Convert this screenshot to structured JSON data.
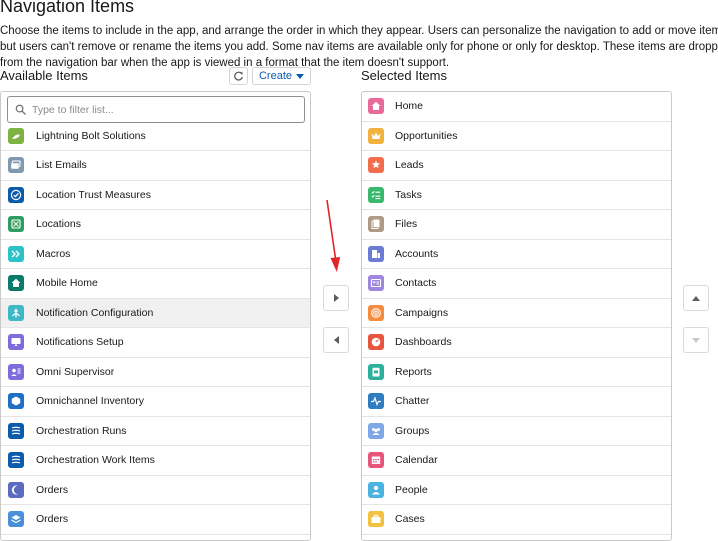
{
  "page": {
    "title": "Navigation Items",
    "description": "Choose the items to include in the app, and arrange the order in which they appear. Users can personalize the navigation to add or move items, but users can't remove or rename the items you add. Some nav items are available only for phone or only for desktop. These items are dropped from the navigation bar when the app is viewed in a format that the item doesn't support."
  },
  "available": {
    "label": "Available Items",
    "create_label": "Create",
    "filter_placeholder": "Type to filter list...",
    "items": [
      {
        "label": "Lightning Bolt Solutions",
        "icon": "lightning-bolt-icon",
        "color": "#7cb342"
      },
      {
        "label": "List Emails",
        "icon": "email-list-icon",
        "color": "#8199af"
      },
      {
        "label": "Location Trust Measures",
        "icon": "shield-check-icon",
        "color": "#0b5cab"
      },
      {
        "label": "Locations",
        "icon": "location-icon",
        "color": "#2e9d5f"
      },
      {
        "label": "Macros",
        "icon": "macros-icon",
        "color": "#2bc3c9"
      },
      {
        "label": "Mobile Home",
        "icon": "home-icon",
        "color": "#0a7a6b"
      },
      {
        "label": "Notification Configuration",
        "icon": "notification-config-icon",
        "color": "#3cb8c6"
      },
      {
        "label": "Notifications Setup",
        "icon": "monitor-icon",
        "color": "#7f6bd9"
      },
      {
        "label": "Omni Supervisor",
        "icon": "supervisor-icon",
        "color": "#7f6bd9"
      },
      {
        "label": "Omnichannel Inventory",
        "icon": "cube-icon",
        "color": "#1f6fc5"
      },
      {
        "label": "Orchestration Runs",
        "icon": "orchestration-icon",
        "color": "#0b5cab"
      },
      {
        "label": "Orchestration Work Items",
        "icon": "orchestration-icon",
        "color": "#0b5cab"
      },
      {
        "label": "Orders",
        "icon": "moon-icon",
        "color": "#5c6bc0"
      },
      {
        "label": "Orders",
        "icon": "stack-icon",
        "color": "#4a90d9"
      }
    ]
  },
  "selected": {
    "label": "Selected Items",
    "items": [
      {
        "label": "Home",
        "icon": "home-icon",
        "color": "#e86b9a"
      },
      {
        "label": "Opportunities",
        "icon": "crown-icon",
        "color": "#f2b13e"
      },
      {
        "label": "Leads",
        "icon": "star-person-icon",
        "color": "#f26d4c"
      },
      {
        "label": "Tasks",
        "icon": "checklist-icon",
        "color": "#39b86e"
      },
      {
        "label": "Files",
        "icon": "files-icon",
        "color": "#b09a85"
      },
      {
        "label": "Accounts",
        "icon": "building-icon",
        "color": "#6b7bd6"
      },
      {
        "label": "Contacts",
        "icon": "contact-card-icon",
        "color": "#9d85e0"
      },
      {
        "label": "Campaigns",
        "icon": "target-icon",
        "color": "#f58b3f"
      },
      {
        "label": "Dashboards",
        "icon": "gauge-icon",
        "color": "#e8553e"
      },
      {
        "label": "Reports",
        "icon": "report-icon",
        "color": "#2bb09b"
      },
      {
        "label": "Chatter",
        "icon": "pulse-icon",
        "color": "#2f7cc0"
      },
      {
        "label": "Groups",
        "icon": "groups-icon",
        "color": "#7fa8e8"
      },
      {
        "label": "Calendar",
        "icon": "calendar-icon",
        "color": "#e8557a"
      },
      {
        "label": "People",
        "icon": "person-icon",
        "color": "#4ab3e0"
      },
      {
        "label": "Cases",
        "icon": "briefcase-icon",
        "color": "#f2c140"
      }
    ]
  },
  "colors": {
    "accent": "#0b5cab",
    "annotation_arrow": "#e0262a",
    "border": "#c9c9c9",
    "selected_row": "#f0f0f0"
  }
}
